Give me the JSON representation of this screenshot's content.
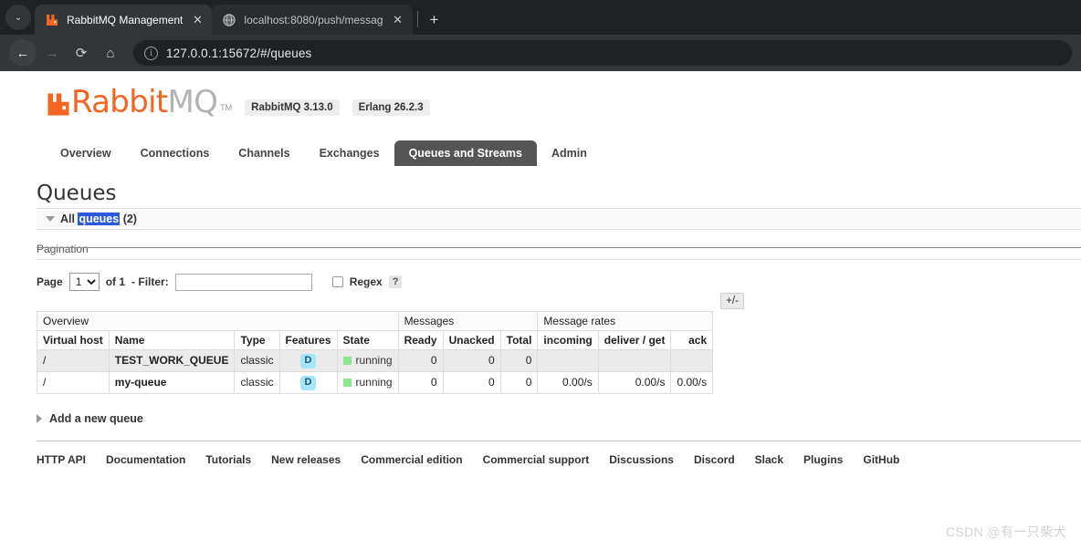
{
  "browser": {
    "tabs": [
      {
        "title": "RabbitMQ Management",
        "favicon": "rabbitmq-icon",
        "active": true
      },
      {
        "title": "localhost:8080/push/messag",
        "favicon": "globe-icon",
        "active": false
      }
    ],
    "new_tab_label": "+",
    "tab_list_label": "⌄",
    "close_label": "✕",
    "nav": {
      "back": "←",
      "forward": "→",
      "reload": "⟳",
      "home": "⌂"
    },
    "omnibox": {
      "info_icon": "i",
      "url": "127.0.0.1:15672/#/queues"
    }
  },
  "app": {
    "logo": {
      "rabbit": "Rabbit",
      "mq": "MQ",
      "tm": "TM"
    },
    "versions": [
      {
        "label": "RabbitMQ 3.13.0"
      },
      {
        "label": "Erlang 26.2.3"
      }
    ],
    "nav_tabs": [
      {
        "label": "Overview",
        "active": false
      },
      {
        "label": "Connections",
        "active": false
      },
      {
        "label": "Channels",
        "active": false
      },
      {
        "label": "Exchanges",
        "active": false
      },
      {
        "label": "Queues and Streams",
        "active": true
      },
      {
        "label": "Admin",
        "active": false
      }
    ]
  },
  "main": {
    "page_title": "Queues",
    "all_queues": {
      "prefix": "All ",
      "highlighted": "queues",
      "suffix": " (2)"
    },
    "pagination_title": "Pagination",
    "filter": {
      "page_label": "Page",
      "page_value": "1",
      "page_options": [
        "1"
      ],
      "of_label": "of 1",
      "dash_filter_label": "- Filter:",
      "filter_value": "",
      "filter_placeholder": "",
      "regex_label": "Regex",
      "regex_checked": false,
      "help_label": "?"
    },
    "table": {
      "group_headers": [
        {
          "label": "Overview",
          "span": 5
        },
        {
          "label": "Messages",
          "span": 3
        },
        {
          "label": "Message rates",
          "span": 3
        }
      ],
      "plus_minus_label": "+/-",
      "columns": [
        {
          "label": "Virtual host",
          "align": "left"
        },
        {
          "label": "Name",
          "align": "left"
        },
        {
          "label": "Type",
          "align": "left"
        },
        {
          "label": "Features",
          "align": "left"
        },
        {
          "label": "State",
          "align": "left"
        },
        {
          "label": "Ready",
          "align": "right"
        },
        {
          "label": "Unacked",
          "align": "right"
        },
        {
          "label": "Total",
          "align": "right"
        },
        {
          "label": "incoming",
          "align": "right"
        },
        {
          "label": "deliver / get",
          "align": "right"
        },
        {
          "label": "ack",
          "align": "right"
        }
      ],
      "rows": [
        {
          "vhost": "/",
          "name": "TEST_WORK_QUEUE",
          "type": "classic",
          "features": "D",
          "state": "running",
          "ready": "0",
          "unacked": "0",
          "total": "0",
          "incoming": "",
          "deliver_get": "",
          "ack": ""
        },
        {
          "vhost": "/",
          "name": "my-queue",
          "type": "classic",
          "features": "D",
          "state": "running",
          "ready": "0",
          "unacked": "0",
          "total": "0",
          "incoming": "0.00/s",
          "deliver_get": "0.00/s",
          "ack": "0.00/s"
        }
      ]
    },
    "add_queue_label": "Add a new queue"
  },
  "footer": {
    "links": [
      "HTTP API",
      "Documentation",
      "Tutorials",
      "New releases",
      "Commercial edition",
      "Commercial support",
      "Discussions",
      "Discord",
      "Slack",
      "Plugins",
      "GitHub"
    ]
  },
  "watermark": "CSDN @有一只柴犬",
  "colors": {
    "brand_orange": "#f26522",
    "active_tab_bg": "#555555",
    "state_running": "#8ae68a",
    "feature_badge": "#a7e6fa",
    "selection_blue": "#2a5adb"
  }
}
